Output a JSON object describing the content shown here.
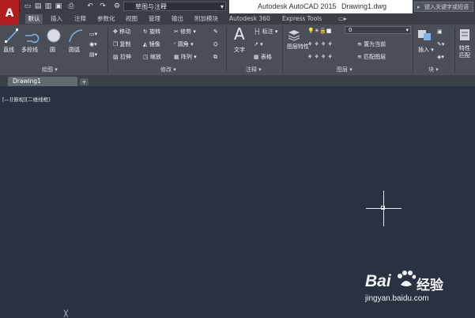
{
  "app": {
    "logo": "A"
  },
  "quick_access": {
    "icons": [
      "open-icon",
      "save-icon",
      "saveas-icon",
      "plot-icon",
      "undo-icon",
      "redo-icon",
      "gear-icon"
    ],
    "workspace": "草图与注释"
  },
  "title": {
    "app_name": "Autodesk AutoCAD 2015",
    "document": "Drawing1.dwg"
  },
  "search": {
    "placeholder": "键入关键字或短语"
  },
  "ribbon_tabs": [
    {
      "label": "默认",
      "active": true
    },
    {
      "label": "插入"
    },
    {
      "label": "注释"
    },
    {
      "label": "参数化"
    },
    {
      "label": "视图"
    },
    {
      "label": "管理"
    },
    {
      "label": "输出"
    },
    {
      "label": "附加模块"
    },
    {
      "label": "Autodesk 360"
    },
    {
      "label": "Express Tools"
    }
  ],
  "panels": {
    "draw": {
      "title": "绘图",
      "items": [
        "直线",
        "多段线",
        "圆",
        "圆弧"
      ]
    },
    "modify": {
      "title": "修改",
      "items": [
        "移动",
        "旋转",
        "修剪",
        "复制",
        "镜像",
        "圆角",
        "拉伸",
        "缩放",
        "阵列"
      ]
    },
    "annotation": {
      "title": "注释",
      "items": [
        "文字",
        "标注",
        "表格"
      ]
    },
    "layers": {
      "title": "图层",
      "items": [
        "图层特性",
        "置为当前",
        "匹配图层"
      ],
      "current_layer": "0"
    },
    "block": {
      "title": "块",
      "items": [
        "插入"
      ]
    },
    "properties": {
      "items": [
        "特性",
        "匹配"
      ]
    }
  },
  "document_tabs": [
    {
      "label": "Drawing1"
    }
  ],
  "viewport": {
    "label": "[—][俯视][二维线框]"
  },
  "watermark": {
    "brand_part1": "Bai",
    "brand_part2": "经验",
    "url": "jingyan.baidu.com"
  },
  "colors": {
    "canvas": "#2a3140",
    "ribbon": "#4a4f57",
    "app_button": "#b21e1e"
  }
}
